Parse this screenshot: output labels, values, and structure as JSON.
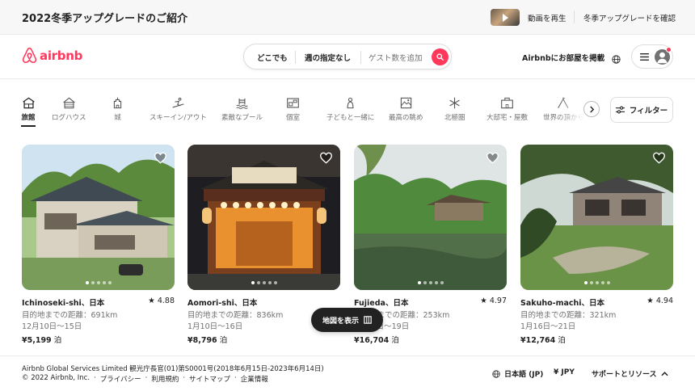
{
  "promo": {
    "title": "2022冬季アップグレードのご紹介",
    "play_label": "動画を再生",
    "confirm_label": "冬季アップグレードを確認"
  },
  "header": {
    "logo_text": "airbnb",
    "search": {
      "where": "どこでも",
      "when": "週の指定なし",
      "guests_placeholder": "ゲスト数を追加"
    },
    "host_label": "Airbnbにお部屋を掲載",
    "icons": [
      "globe-icon",
      "menu-icon",
      "avatar-icon"
    ]
  },
  "categories": [
    {
      "label": "旅館",
      "icon": "ryokan-icon",
      "active": true
    },
    {
      "label": "ログハウス",
      "icon": "cabin-icon"
    },
    {
      "label": "城",
      "icon": "castle-icon"
    },
    {
      "label": "スキーイン/アウト",
      "icon": "ski-icon"
    },
    {
      "label": "素敵なプール",
      "icon": "pool-icon"
    },
    {
      "label": "個室",
      "icon": "room-icon"
    },
    {
      "label": "子どもと一緒に",
      "icon": "kids-icon"
    },
    {
      "label": "最高の眺め",
      "icon": "view-icon"
    },
    {
      "label": "北極圏",
      "icon": "snowflake-icon"
    },
    {
      "label": "大邸宅・屋敷",
      "icon": "mansion-icon"
    },
    {
      "label": "世界の頂から",
      "icon": "peak-icon"
    }
  ],
  "filter_label": "フィルター",
  "listings": [
    {
      "location": "Ichinoseki-shi、日本",
      "rating": "4.88",
      "distance": "目的地までの距離：691km",
      "dates": "12月10日〜15日",
      "price": "¥5,199",
      "unit": "泊"
    },
    {
      "location": "Aomori-shi、日本",
      "rating": "",
      "distance": "目的地までの距離：836km",
      "dates": "1月10日〜16日",
      "price": "¥8,796",
      "unit": "泊"
    },
    {
      "location": "Fujieda、日本",
      "rating": "4.97",
      "distance": "目的地までの距離：253km",
      "dates": "1月14日〜19日",
      "price": "¥16,704",
      "unit": "泊"
    },
    {
      "location": "Sakuho-machi、日本",
      "rating": "4.94",
      "distance": "目的地までの距離：321km",
      "dates": "1月16日〜21日",
      "price": "¥12,764",
      "unit": "泊"
    }
  ],
  "map_button_label": "地図を表示",
  "footer": {
    "company": "Airbnb Global Services Limited 観光庁長官(01)第S0001号(2018年6月15日-2023年6月14日)",
    "copyright": "© 2022 Airbnb, Inc.",
    "links": [
      "プライバシー",
      "利用規約",
      "サイトマップ",
      "企業情報"
    ],
    "separator": "·",
    "language": "日本語 (JP)",
    "currency_symbol": "¥",
    "currency": "JPY",
    "support": "サポートとリソース"
  },
  "colors": {
    "brand": "#FF385C",
    "text": "#222222",
    "muted": "#717171"
  }
}
